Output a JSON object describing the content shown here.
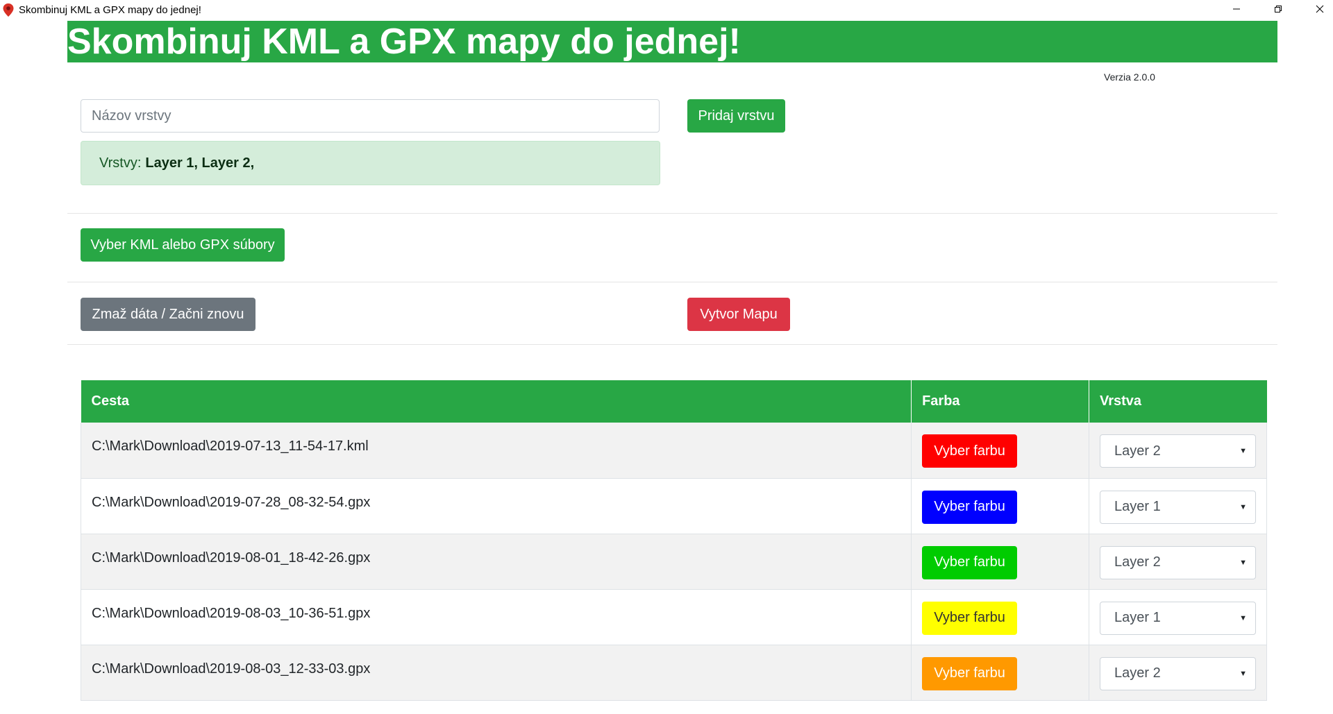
{
  "window": {
    "title": "Skombinuj KML a GPX mapy do jednej!"
  },
  "header": {
    "title": "Skombinuj KML a GPX mapy do jednej!",
    "version": "Verzia 2.0.0"
  },
  "layer_form": {
    "input_placeholder": "Názov vrstvy",
    "input_value": "",
    "add_button": "Pridaj vrstvu",
    "alert_label": "Vrstvy:",
    "alert_layers": "Layer 1, Layer 2,"
  },
  "actions": {
    "select_files": "Vyber KML alebo GPX súbory",
    "reset": "Zmaž dáta / Začni znovu",
    "create_map": "Vytvor Mapu"
  },
  "table": {
    "headers": [
      "Cesta",
      "Farba",
      "Vrstva"
    ],
    "rows": [
      {
        "path": "C:\\Mark\\Download\\2019-07-13_11-54-17.kml",
        "color_label": "Vyber farbu",
        "color": "#ff0000",
        "text_color": "#ffffff",
        "layer": "Layer 2"
      },
      {
        "path": "C:\\Mark\\Download\\2019-07-28_08-32-54.gpx",
        "color_label": "Vyber farbu",
        "color": "#0000ff",
        "text_color": "#ffffff",
        "layer": "Layer 1"
      },
      {
        "path": "C:\\Mark\\Download\\2019-08-01_18-42-26.gpx",
        "color_label": "Vyber farbu",
        "color": "#00cc00",
        "text_color": "#ffffff",
        "layer": "Layer 2"
      },
      {
        "path": "C:\\Mark\\Download\\2019-08-03_10-36-51.gpx",
        "color_label": "Vyber farbu",
        "color": "#ffff00",
        "text_color": "#333333",
        "layer": "Layer 1"
      },
      {
        "path": "C:\\Mark\\Download\\2019-08-03_12-33-03.gpx",
        "color_label": "Vyber farbu",
        "color": "#ff9900",
        "text_color": "#ffffff",
        "layer": "Layer 2"
      }
    ]
  },
  "colors": {
    "accent": "#28a745",
    "danger": "#dc3545",
    "secondary": "#6c757d",
    "alert_bg": "#d4edda"
  }
}
